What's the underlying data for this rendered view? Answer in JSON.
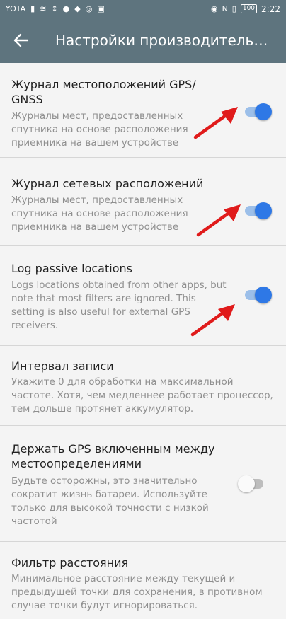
{
  "status_bar": {
    "carrier": "YOTA",
    "battery": "100",
    "time": "2:22"
  },
  "toolbar": {
    "title": "Настройки производительно..."
  },
  "settings": [
    {
      "title": "Журнал местоположений GPS/ GNSS",
      "summary": "Журналы мест, предоставленных спутника на основе расположения приемника на вашем устройстве",
      "toggle": "on"
    },
    {
      "title": "Журнал сетевых расположений",
      "summary": "Журналы мест, предоставленных спутника на основе расположения приемника на вашем устройстве",
      "toggle": "on"
    },
    {
      "title": "Log passive locations",
      "summary": "Logs locations obtained from other apps, but note that most filters are ignored. This setting is also useful for external GPS receivers.",
      "toggle": "on"
    },
    {
      "title": "Интервал записи",
      "summary": "Укажите 0 для обработки на максимальной частоте. Хотя, чем медленнее работает процессор, тем дольше протянет аккумулятор."
    },
    {
      "title": "Держать GPS включенным между местоопределениями",
      "summary": "Будьте осторожны, это значительно сократит жизнь батареи. Используйте только для высокой точности с низкой частотой",
      "toggle": "off"
    },
    {
      "title": "Фильтр расстояния",
      "summary": "Минимальное расстояние между текущей и предыдущей точки для сохранения, в противном случае точки будут игнорироваться."
    }
  ],
  "colors": {
    "toolbar": "#5e747e",
    "switch_on": "#2e78e6",
    "annotation_arrow": "#e01b1b"
  }
}
